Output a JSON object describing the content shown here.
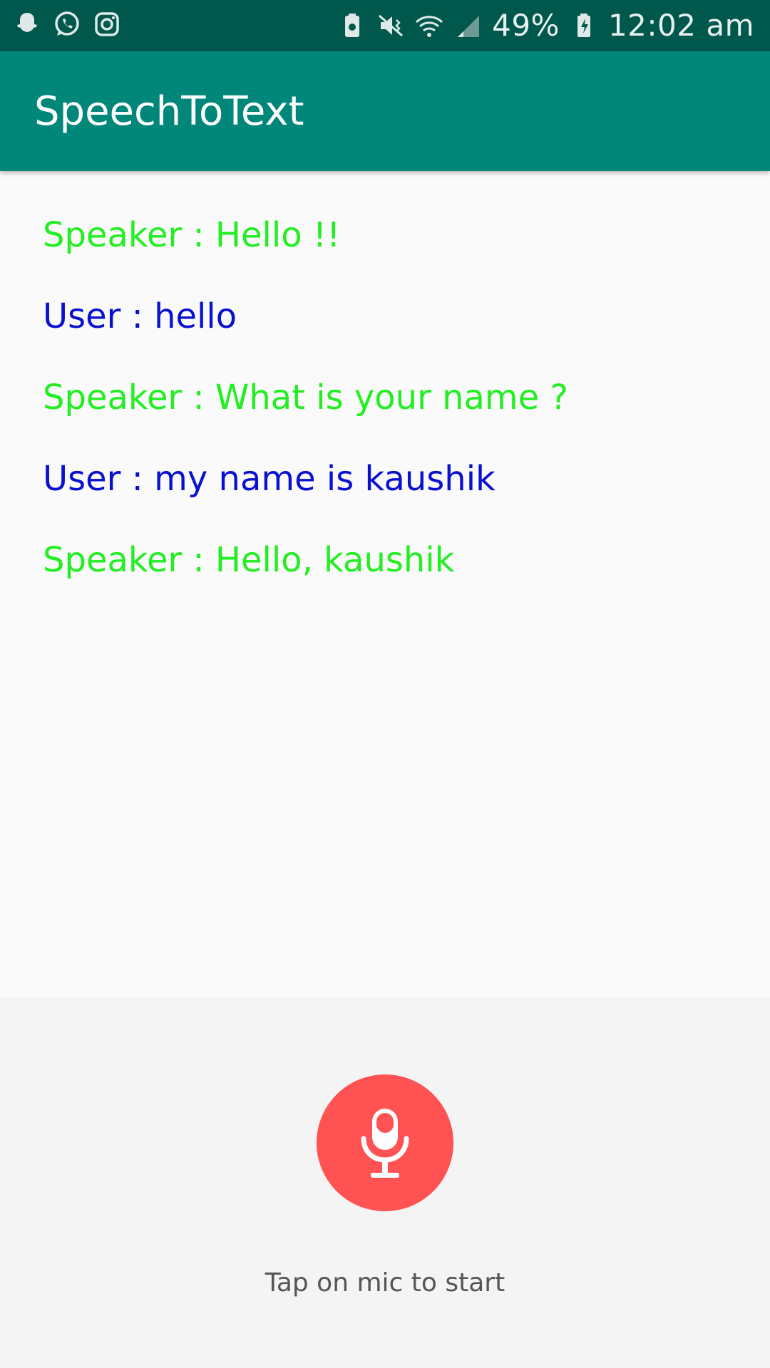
{
  "status_bar": {
    "left_icons": [
      "snapchat-icon",
      "whatsapp-icon",
      "instagram-icon"
    ],
    "battery_percent": "49%",
    "time": "12:02 am"
  },
  "app_bar": {
    "title": "SpeechToText"
  },
  "conversation": [
    {
      "role": "speaker",
      "text": "Speaker : Hello !!"
    },
    {
      "role": "user",
      "text": "User : hello"
    },
    {
      "role": "speaker",
      "text": "Speaker : What is your name ?"
    },
    {
      "role": "user",
      "text": "User : my name is kaushik"
    },
    {
      "role": "speaker",
      "text": "Speaker : Hello, kaushik"
    }
  ],
  "mic": {
    "icon": "mic-icon",
    "hint": "Tap on mic to start"
  },
  "colors": {
    "status_bar": "#00574b",
    "app_bar": "#00877a",
    "speaker_text": "#22ee22",
    "user_text": "#0a10cf",
    "mic_button": "#ff5252"
  }
}
